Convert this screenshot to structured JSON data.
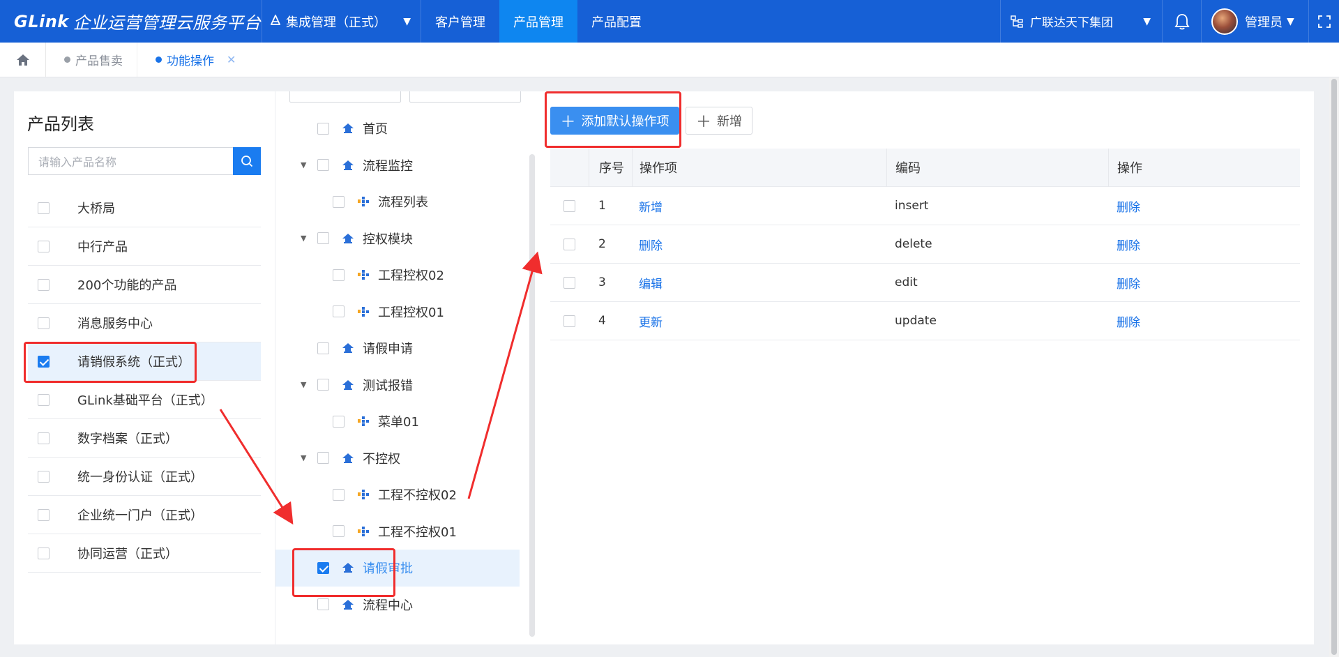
{
  "header": {
    "logo_brand": "GLink",
    "logo_title": "企业运营管理云服务平台",
    "system_select": "集成管理（正式）",
    "nav": [
      {
        "label": "客户管理"
      },
      {
        "label": "产品管理"
      },
      {
        "label": "产品配置"
      }
    ],
    "org": "广联达天下集团",
    "user": "管理员"
  },
  "tabs": [
    {
      "label": "产品售卖"
    },
    {
      "label": "功能操作"
    }
  ],
  "product_panel": {
    "title": "产品列表",
    "search_placeholder": "请输入产品名称",
    "items": [
      {
        "label": "大桥局",
        "checked": false
      },
      {
        "label": "中行产品",
        "checked": false
      },
      {
        "label": "200个功能的产品",
        "checked": false
      },
      {
        "label": "消息服务中心",
        "checked": false
      },
      {
        "label": "请销假系统（正式）",
        "checked": true
      },
      {
        "label": "GLink基础平台（正式）",
        "checked": false
      },
      {
        "label": "数字档案（正式）",
        "checked": false
      },
      {
        "label": "统一身份认证（正式）",
        "checked": false
      },
      {
        "label": "企业统一门户（正式）",
        "checked": false
      },
      {
        "label": "协同运营（正式）",
        "checked": false
      }
    ]
  },
  "tree": {
    "nodes": [
      {
        "label": "首页",
        "level": 0,
        "expandable": false,
        "checked": false
      },
      {
        "label": "流程监控",
        "level": 0,
        "expandable": true,
        "checked": false
      },
      {
        "label": "流程列表",
        "level": 1,
        "expandable": false,
        "checked": false
      },
      {
        "label": "控权模块",
        "level": 0,
        "expandable": true,
        "checked": false
      },
      {
        "label": "工程控权02",
        "level": 1,
        "expandable": false,
        "checked": false
      },
      {
        "label": "工程控权01",
        "level": 1,
        "expandable": false,
        "checked": false
      },
      {
        "label": "请假申请",
        "level": 0,
        "expandable": false,
        "checked": false
      },
      {
        "label": "测试报错",
        "level": 0,
        "expandable": true,
        "checked": false
      },
      {
        "label": "菜单01",
        "level": 1,
        "expandable": false,
        "checked": false
      },
      {
        "label": "不控权",
        "level": 0,
        "expandable": true,
        "checked": false
      },
      {
        "label": "工程不控权02",
        "level": 1,
        "expandable": false,
        "checked": false
      },
      {
        "label": "工程不控权01",
        "level": 1,
        "expandable": false,
        "checked": false
      },
      {
        "label": "请假审批",
        "level": 0,
        "expandable": false,
        "checked": true
      },
      {
        "label": "流程中心",
        "level": 0,
        "expandable": false,
        "checked": false
      }
    ]
  },
  "operations": {
    "add_default_label": "添加默认操作项",
    "add_label": "新增",
    "columns": [
      "序号",
      "操作项",
      "编码",
      "操作"
    ],
    "rows": [
      {
        "no": "1",
        "name": "新增",
        "code": "insert",
        "action": "删除"
      },
      {
        "no": "2",
        "name": "删除",
        "code": "delete",
        "action": "删除"
      },
      {
        "no": "3",
        "name": "编辑",
        "code": "edit",
        "action": "删除"
      },
      {
        "no": "4",
        "name": "更新",
        "code": "update",
        "action": "删除"
      }
    ]
  },
  "colors": {
    "header_bg": "#1660d6",
    "nav_active": "#0e86f0",
    "primary": "#3a8ff0",
    "link": "#1a73e8",
    "annotation": "#f02d2d"
  },
  "icons": [
    "system-icon",
    "org-icon",
    "bell-icon",
    "fullscreen-icon",
    "home-icon",
    "search-icon",
    "menu-node-icon",
    "page-node-icon",
    "plus-icon"
  ]
}
